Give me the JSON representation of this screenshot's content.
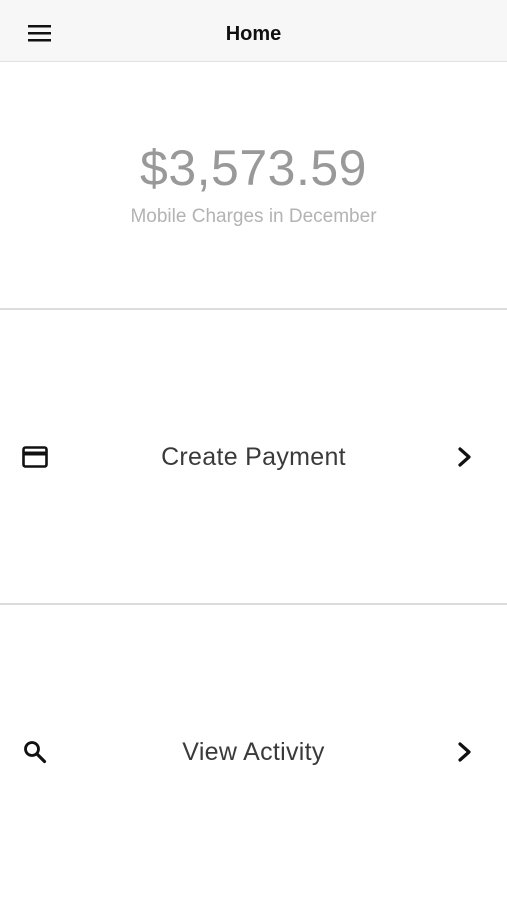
{
  "header": {
    "title": "Home",
    "menu_icon": "hamburger-menu-icon"
  },
  "summary": {
    "amount": "$3,573.59",
    "caption": "Mobile Charges in December"
  },
  "actions": [
    {
      "label": "Create Payment",
      "icon": "credit-card-icon",
      "chevron": "chevron-right-icon"
    },
    {
      "label": "View Activity",
      "icon": "search-icon",
      "chevron": "chevron-right-icon"
    }
  ],
  "colors": {
    "header_bg": "#f7f7f7",
    "amount_text": "#999999",
    "caption_text": "#b3b3b3",
    "label_text": "#3a3a3a",
    "divider": "#dcdcdc"
  }
}
